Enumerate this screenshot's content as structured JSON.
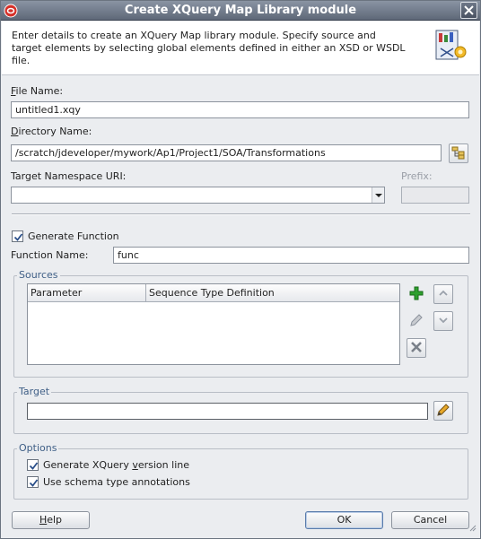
{
  "window": {
    "title": "Create XQuery Map Library module"
  },
  "header": {
    "description": "Enter details to create an XQuery Map library module. Specify source and target elements by selecting global elements defined in either an XSD or WSDL file."
  },
  "fields": {
    "file_name_label_u": "F",
    "file_name_label_rest": "ile Name:",
    "file_name_value": "untitled1.xqy",
    "directory_label_u": "D",
    "directory_label_rest": "irectory Name:",
    "directory_value": "/scratch/jdeveloper/mywork/Ap1/Project1/SOA/Transformations",
    "namespace_label": "Target Namespace URI:",
    "namespace_value": "",
    "prefix_label": "Prefix:",
    "prefix_value": ""
  },
  "function": {
    "generate_label": "Generate Function",
    "generate_checked": true,
    "name_label": "Function Name:",
    "name_value": "func"
  },
  "sources": {
    "title": "Sources",
    "columns": [
      "Parameter",
      "Sequence Type Definition"
    ],
    "rows": []
  },
  "target": {
    "title": "Target",
    "value": ""
  },
  "options": {
    "title": "Options",
    "version_label_a": "Generate XQuery ",
    "version_label_u": "v",
    "version_label_b": "ersion line",
    "version_checked": true,
    "schema_label": "Use schema type annotations",
    "schema_checked": true
  },
  "buttons": {
    "help_u": "H",
    "help_rest": "elp",
    "ok": "OK",
    "cancel": "Cancel"
  },
  "colors": {
    "group_title": "#3f5f86",
    "add_icon": "#2ea12e"
  }
}
